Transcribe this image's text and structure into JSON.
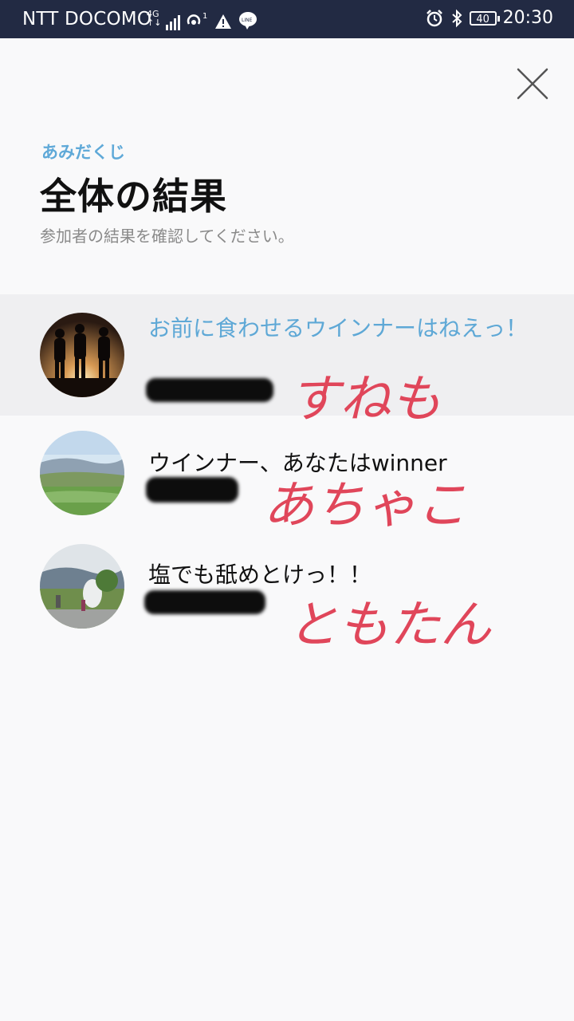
{
  "status_bar": {
    "carrier": "NTT DOCOMO",
    "network_type_top": "4G",
    "network_type_bottom": "↑↓",
    "battery": "40",
    "time": "20:30",
    "icons": [
      "signal-icon",
      "hotspot-icon",
      "warning-icon",
      "line-app-icon",
      "alarm-icon",
      "bluetooth-icon",
      "battery-icon"
    ]
  },
  "header": {
    "eyebrow": "あみだくじ",
    "title": "全体の結果",
    "subtitle": "参加者の結果を確認してください。"
  },
  "results": [
    {
      "text": "お前に食わせるウインナーはねえっ！",
      "annotation": "すねも",
      "avatar": "silhouettes-sunset"
    },
    {
      "text": "ウインナー、あなたはwinner",
      "annotation": "あちゃこ",
      "avatar": "green-hills"
    },
    {
      "text": "塩でも舐めとけっ！！",
      "annotation": "ともたん",
      "avatar": "statue-landscape"
    }
  ],
  "colors": {
    "accent": "#5fa9d8",
    "status_bar": "#222a43",
    "background": "#f9f9fa",
    "highlight": "#efeff1",
    "annotation": "#e0465a"
  }
}
